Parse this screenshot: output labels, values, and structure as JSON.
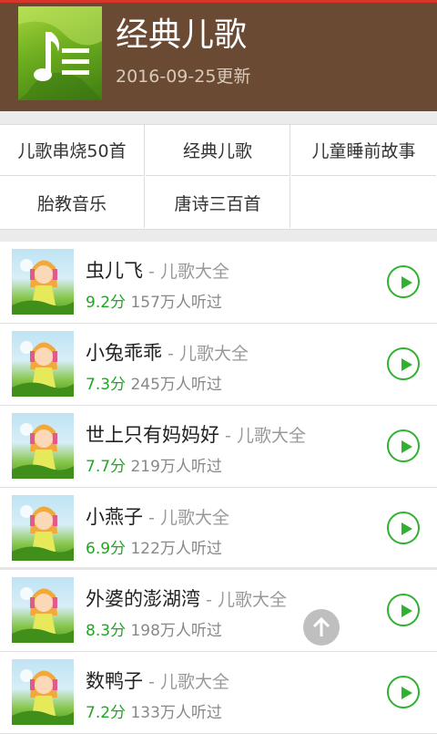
{
  "header": {
    "title": "经典儿歌",
    "date": "2016-09-25更新",
    "art_icon": "music-note-icon"
  },
  "categories": [
    {
      "label": "儿歌串烧50首"
    },
    {
      "label": "经典儿歌"
    },
    {
      "label": "儿童睡前故事"
    },
    {
      "label": "胎教音乐"
    },
    {
      "label": "唐诗三百首"
    }
  ],
  "songs": [
    {
      "title": "虫儿飞",
      "sep": " - ",
      "album": "儿歌大全",
      "score": "9.2分",
      "plays": "157万人听过"
    },
    {
      "title": "小兔乖乖",
      "sep": " - ",
      "album": "儿歌大全",
      "score": "7.3分",
      "plays": "245万人听过"
    },
    {
      "title": "世上只有妈妈好",
      "sep": " - ",
      "album": "儿歌大全",
      "score": "7.7分",
      "plays": "219万人听过"
    },
    {
      "title": "小燕子",
      "sep": " - ",
      "album": "儿歌大全",
      "score": "6.9分",
      "plays": "122万人听过"
    },
    {
      "title": "外婆的澎湖湾",
      "sep": " - ",
      "album": "儿歌大全",
      "score": "8.3分",
      "plays": "198万人听过"
    },
    {
      "title": "数鸭子",
      "sep": " - ",
      "album": "儿歌大全",
      "score": "7.2分",
      "plays": "133万人听过"
    }
  ],
  "colors": {
    "header_bg": "#6b4a33",
    "accent_red": "#d8342a",
    "score_green": "#1fa81f",
    "play_green": "#2fb22f"
  },
  "icons": {
    "play": "play-icon",
    "scroll_top": "arrow-up-icon"
  }
}
